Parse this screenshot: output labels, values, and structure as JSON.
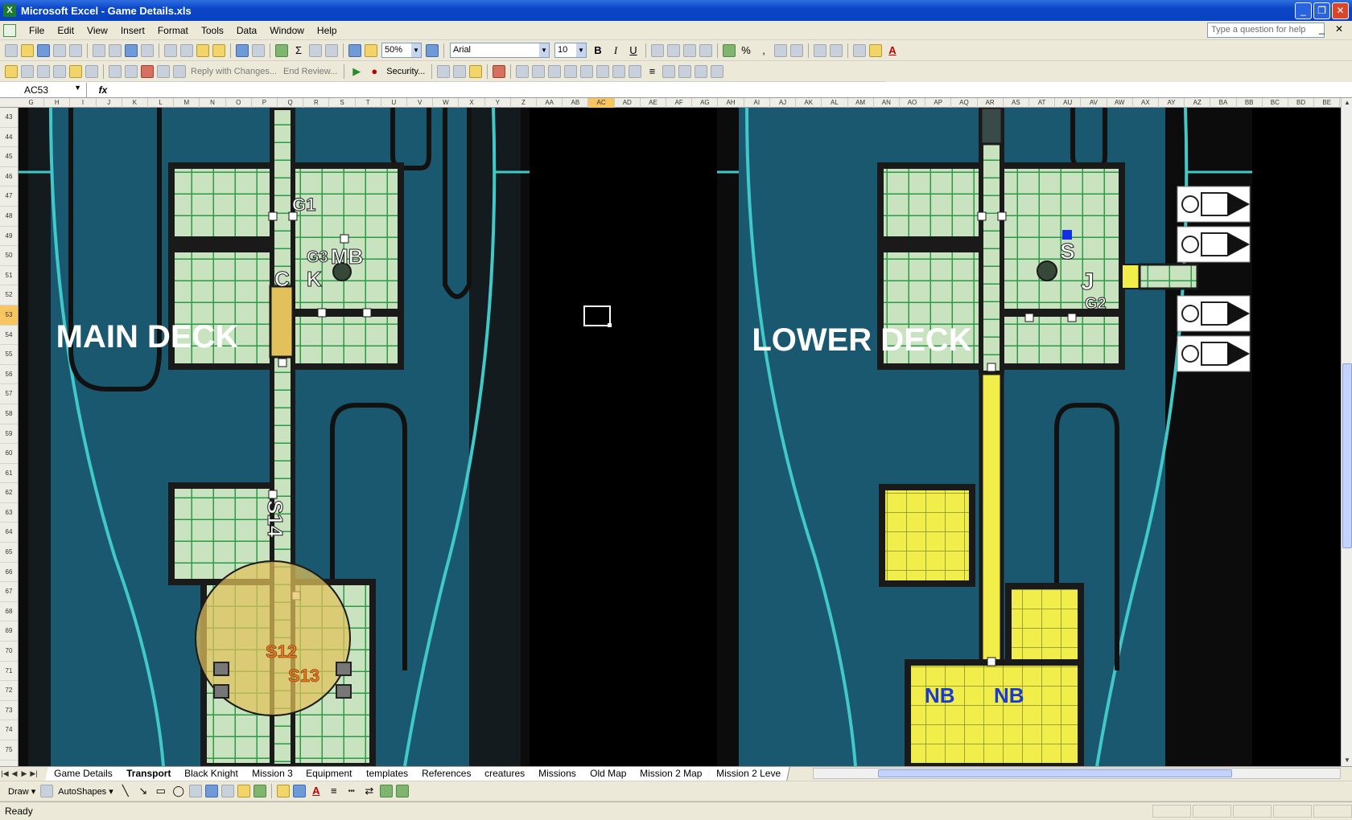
{
  "window": {
    "title": "Microsoft Excel - Game Details.xls"
  },
  "menu": [
    "File",
    "Edit",
    "View",
    "Insert",
    "Format",
    "Tools",
    "Data",
    "Window",
    "Help"
  ],
  "help_placeholder": "Type a question for help",
  "standard_toolbar": {
    "zoom": "50%"
  },
  "formatting_toolbar": {
    "font": "Arial",
    "size": "10",
    "bold": "B",
    "italic": "I",
    "underline": "U",
    "percent": "%",
    "comma": ","
  },
  "reviewing_toolbar": {
    "reply_label": "Reply with Changes...",
    "end_review_label": "End Review...",
    "security_label": "Security..."
  },
  "formula_bar": {
    "name_box": "AC53",
    "fx": "fx",
    "formula": ""
  },
  "columns": [
    "G",
    "H",
    "I",
    "J",
    "K",
    "L",
    "M",
    "N",
    "O",
    "P",
    "Q",
    "R",
    "S",
    "T",
    "U",
    "V",
    "W",
    "X",
    "Y",
    "Z",
    "AA",
    "AB",
    "AC",
    "AD",
    "AE",
    "AF",
    "AG",
    "AH",
    "AI",
    "AJ",
    "AK",
    "AL",
    "AM",
    "AN",
    "AO",
    "AP",
    "AQ",
    "AR",
    "AS",
    "AT",
    "AU",
    "AV",
    "AW",
    "AX",
    "AY",
    "AZ",
    "BA",
    "BB",
    "BC",
    "BD",
    "BE"
  ],
  "selected_column": "AC",
  "rows": [
    "43",
    "44",
    "45",
    "46",
    "47",
    "48",
    "49",
    "50",
    "51",
    "52",
    "53",
    "54",
    "55",
    "56",
    "57",
    "58",
    "59",
    "60",
    "61",
    "62",
    "63",
    "64",
    "65",
    "66",
    "67",
    "68",
    "69",
    "70",
    "71",
    "72",
    "73",
    "74",
    "75"
  ],
  "selected_row": "53",
  "map": {
    "main_deck_title": "MAIN DECK",
    "lower_deck_title": "LOWER DECK",
    "labels": {
      "g1": "G1",
      "g3": "G3",
      "mb": "MB",
      "c": "C",
      "k": "K",
      "s14": "S14",
      "s12": "S12",
      "s13": "S13",
      "s": "S",
      "j": "J",
      "g2": "G2",
      "nb1": "NB",
      "nb2": "NB"
    },
    "colors": {
      "hull": "#1a5870",
      "outline": "#41c8c8",
      "floor": "#c9e2bf",
      "grid": "#2c9a46",
      "yellow": "#f1ed4a",
      "gold": "#e2c05a",
      "orange": "#e57a1e",
      "blue": "#1230e0",
      "space": "#000000"
    }
  },
  "sheet_tabs": [
    "Game Details",
    "Transport",
    "Black Knight",
    "Mission 3",
    "Equipment",
    "templates",
    "References",
    "creatures",
    "Missions",
    "Old Map",
    "Mission 2 Map",
    "Mission 2 Leve"
  ],
  "active_tab": "Transport",
  "drawing_toolbar": {
    "draw": "Draw",
    "autoshapes": "AutoShapes"
  },
  "status": "Ready"
}
